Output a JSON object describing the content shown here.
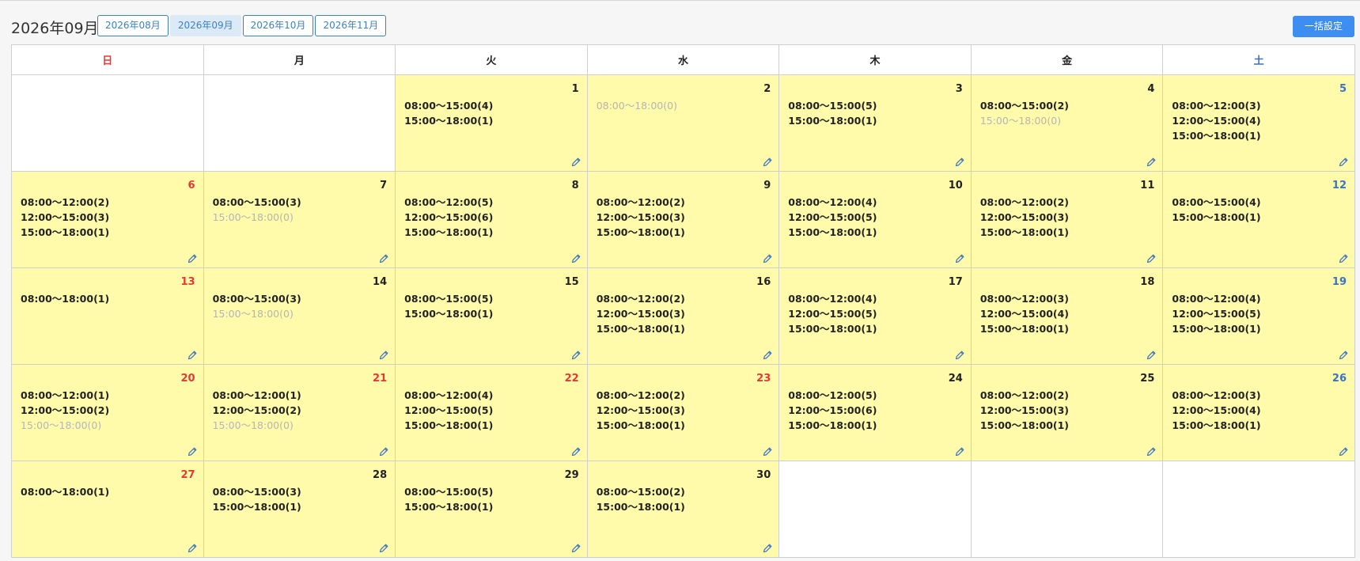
{
  "header": {
    "title": "2026年09月",
    "month_tabs": [
      {
        "label": "2026年08月",
        "active": false
      },
      {
        "label": "2026年09月",
        "active": true
      },
      {
        "label": "2026年10月",
        "active": false
      },
      {
        "label": "2026年11月",
        "active": false
      }
    ],
    "bulk_button": "一括設定"
  },
  "colors": {
    "accent": "#3d8ef0",
    "holiday_red": "#e53935",
    "saturday_blue": "#3b73c4",
    "cell_yellow": "#fffbaa",
    "dim_text": "#b5b5b5"
  },
  "weekdays": [
    {
      "label": "日",
      "type": "sun"
    },
    {
      "label": "月",
      "type": ""
    },
    {
      "label": "火",
      "type": ""
    },
    {
      "label": "水",
      "type": ""
    },
    {
      "label": "木",
      "type": ""
    },
    {
      "label": "金",
      "type": ""
    },
    {
      "label": "土",
      "type": "sat"
    }
  ],
  "edit_icon": "pencil-icon",
  "weeks": [
    [
      null,
      null,
      {
        "day": "1",
        "color": "",
        "slots": [
          {
            "text": "08:00〜15:00(4)",
            "dim": false
          },
          {
            "text": "15:00〜18:00(1)",
            "dim": false
          }
        ]
      },
      {
        "day": "2",
        "color": "",
        "slots": [
          {
            "text": "08:00〜18:00(0)",
            "dim": true
          }
        ]
      },
      {
        "day": "3",
        "color": "",
        "slots": [
          {
            "text": "08:00〜15:00(5)",
            "dim": false
          },
          {
            "text": "15:00〜18:00(1)",
            "dim": false
          }
        ]
      },
      {
        "day": "4",
        "color": "",
        "slots": [
          {
            "text": "08:00〜15:00(2)",
            "dim": false
          },
          {
            "text": "15:00〜18:00(0)",
            "dim": true
          }
        ]
      },
      {
        "day": "5",
        "color": "blue",
        "slots": [
          {
            "text": "08:00〜12:00(3)",
            "dim": false
          },
          {
            "text": "12:00〜15:00(4)",
            "dim": false
          },
          {
            "text": "15:00〜18:00(1)",
            "dim": false
          }
        ]
      }
    ],
    [
      {
        "day": "6",
        "color": "red",
        "slots": [
          {
            "text": "08:00〜12:00(2)",
            "dim": false
          },
          {
            "text": "12:00〜15:00(3)",
            "dim": false
          },
          {
            "text": "15:00〜18:00(1)",
            "dim": false
          }
        ]
      },
      {
        "day": "7",
        "color": "",
        "slots": [
          {
            "text": "08:00〜15:00(3)",
            "dim": false
          },
          {
            "text": "15:00〜18:00(0)",
            "dim": true
          }
        ]
      },
      {
        "day": "8",
        "color": "",
        "slots": [
          {
            "text": "08:00〜12:00(5)",
            "dim": false
          },
          {
            "text": "12:00〜15:00(6)",
            "dim": false
          },
          {
            "text": "15:00〜18:00(1)",
            "dim": false
          }
        ]
      },
      {
        "day": "9",
        "color": "",
        "slots": [
          {
            "text": "08:00〜12:00(2)",
            "dim": false
          },
          {
            "text": "12:00〜15:00(3)",
            "dim": false
          },
          {
            "text": "15:00〜18:00(1)",
            "dim": false
          }
        ]
      },
      {
        "day": "10",
        "color": "",
        "slots": [
          {
            "text": "08:00〜12:00(4)",
            "dim": false
          },
          {
            "text": "12:00〜15:00(5)",
            "dim": false
          },
          {
            "text": "15:00〜18:00(1)",
            "dim": false
          }
        ]
      },
      {
        "day": "11",
        "color": "",
        "slots": [
          {
            "text": "08:00〜12:00(2)",
            "dim": false
          },
          {
            "text": "12:00〜15:00(3)",
            "dim": false
          },
          {
            "text": "15:00〜18:00(1)",
            "dim": false
          }
        ]
      },
      {
        "day": "12",
        "color": "blue",
        "slots": [
          {
            "text": "08:00〜15:00(4)",
            "dim": false
          },
          {
            "text": "15:00〜18:00(1)",
            "dim": false
          }
        ]
      }
    ],
    [
      {
        "day": "13",
        "color": "red",
        "slots": [
          {
            "text": "08:00〜18:00(1)",
            "dim": false
          }
        ]
      },
      {
        "day": "14",
        "color": "",
        "slots": [
          {
            "text": "08:00〜15:00(3)",
            "dim": false
          },
          {
            "text": "15:00〜18:00(0)",
            "dim": true
          }
        ]
      },
      {
        "day": "15",
        "color": "",
        "slots": [
          {
            "text": "08:00〜15:00(5)",
            "dim": false
          },
          {
            "text": "15:00〜18:00(1)",
            "dim": false
          }
        ]
      },
      {
        "day": "16",
        "color": "",
        "slots": [
          {
            "text": "08:00〜12:00(2)",
            "dim": false
          },
          {
            "text": "12:00〜15:00(3)",
            "dim": false
          },
          {
            "text": "15:00〜18:00(1)",
            "dim": false
          }
        ]
      },
      {
        "day": "17",
        "color": "",
        "slots": [
          {
            "text": "08:00〜12:00(4)",
            "dim": false
          },
          {
            "text": "12:00〜15:00(5)",
            "dim": false
          },
          {
            "text": "15:00〜18:00(1)",
            "dim": false
          }
        ]
      },
      {
        "day": "18",
        "color": "",
        "slots": [
          {
            "text": "08:00〜12:00(3)",
            "dim": false
          },
          {
            "text": "12:00〜15:00(4)",
            "dim": false
          },
          {
            "text": "15:00〜18:00(1)",
            "dim": false
          }
        ]
      },
      {
        "day": "19",
        "color": "blue",
        "slots": [
          {
            "text": "08:00〜12:00(4)",
            "dim": false
          },
          {
            "text": "12:00〜15:00(5)",
            "dim": false
          },
          {
            "text": "15:00〜18:00(1)",
            "dim": false
          }
        ]
      }
    ],
    [
      {
        "day": "20",
        "color": "red",
        "slots": [
          {
            "text": "08:00〜12:00(1)",
            "dim": false
          },
          {
            "text": "12:00〜15:00(2)",
            "dim": false
          },
          {
            "text": "15:00〜18:00(0)",
            "dim": true
          }
        ]
      },
      {
        "day": "21",
        "color": "red",
        "slots": [
          {
            "text": "08:00〜12:00(1)",
            "dim": false
          },
          {
            "text": "12:00〜15:00(2)",
            "dim": false
          },
          {
            "text": "15:00〜18:00(0)",
            "dim": true
          }
        ]
      },
      {
        "day": "22",
        "color": "red",
        "slots": [
          {
            "text": "08:00〜12:00(4)",
            "dim": false
          },
          {
            "text": "12:00〜15:00(5)",
            "dim": false
          },
          {
            "text": "15:00〜18:00(1)",
            "dim": false
          }
        ]
      },
      {
        "day": "23",
        "color": "red",
        "slots": [
          {
            "text": "08:00〜12:00(2)",
            "dim": false
          },
          {
            "text": "12:00〜15:00(3)",
            "dim": false
          },
          {
            "text": "15:00〜18:00(1)",
            "dim": false
          }
        ]
      },
      {
        "day": "24",
        "color": "",
        "slots": [
          {
            "text": "08:00〜12:00(5)",
            "dim": false
          },
          {
            "text": "12:00〜15:00(6)",
            "dim": false
          },
          {
            "text": "15:00〜18:00(1)",
            "dim": false
          }
        ]
      },
      {
        "day": "25",
        "color": "",
        "slots": [
          {
            "text": "08:00〜12:00(2)",
            "dim": false
          },
          {
            "text": "12:00〜15:00(3)",
            "dim": false
          },
          {
            "text": "15:00〜18:00(1)",
            "dim": false
          }
        ]
      },
      {
        "day": "26",
        "color": "blue",
        "slots": [
          {
            "text": "08:00〜12:00(3)",
            "dim": false
          },
          {
            "text": "12:00〜15:00(4)",
            "dim": false
          },
          {
            "text": "15:00〜18:00(1)",
            "dim": false
          }
        ]
      }
    ],
    [
      {
        "day": "27",
        "color": "red",
        "slots": [
          {
            "text": "08:00〜18:00(1)",
            "dim": false
          }
        ]
      },
      {
        "day": "28",
        "color": "",
        "slots": [
          {
            "text": "08:00〜15:00(3)",
            "dim": false
          },
          {
            "text": "15:00〜18:00(1)",
            "dim": false
          }
        ]
      },
      {
        "day": "29",
        "color": "",
        "slots": [
          {
            "text": "08:00〜15:00(5)",
            "dim": false
          },
          {
            "text": "15:00〜18:00(1)",
            "dim": false
          }
        ]
      },
      {
        "day": "30",
        "color": "",
        "slots": [
          {
            "text": "08:00〜15:00(2)",
            "dim": false
          },
          {
            "text": "15:00〜18:00(1)",
            "dim": false
          }
        ]
      },
      null,
      null,
      null
    ]
  ]
}
